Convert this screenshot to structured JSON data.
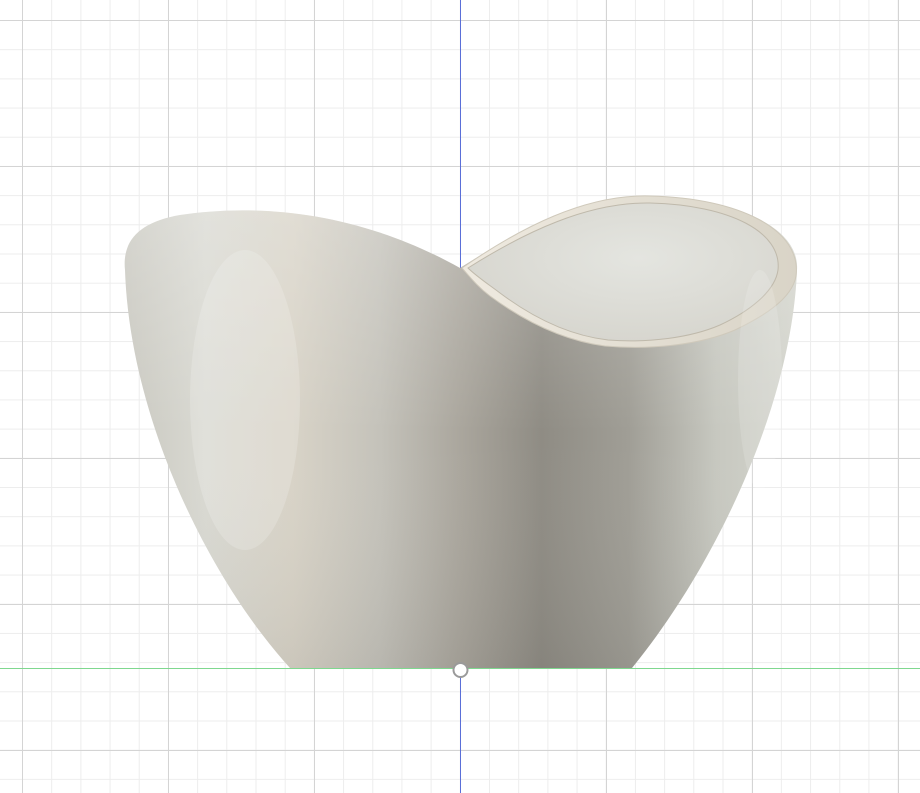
{
  "viewport": {
    "background": "#ffffff",
    "grid_major_color": "#d4d4d4",
    "grid_minor_color": "#ededed"
  },
  "axes": {
    "vertical_axis_color": "#5a6fd8",
    "horizontal_axis_color": "#7fd88f"
  },
  "model": {
    "name": "wavy-vase-body",
    "surface_color": "#d6d5cd",
    "shadow_color": "#8f8c84",
    "rim_color": "#e9e5dc"
  },
  "origin_marker": {
    "icon": "origin-ring-icon",
    "color": "#9a9a9a"
  }
}
